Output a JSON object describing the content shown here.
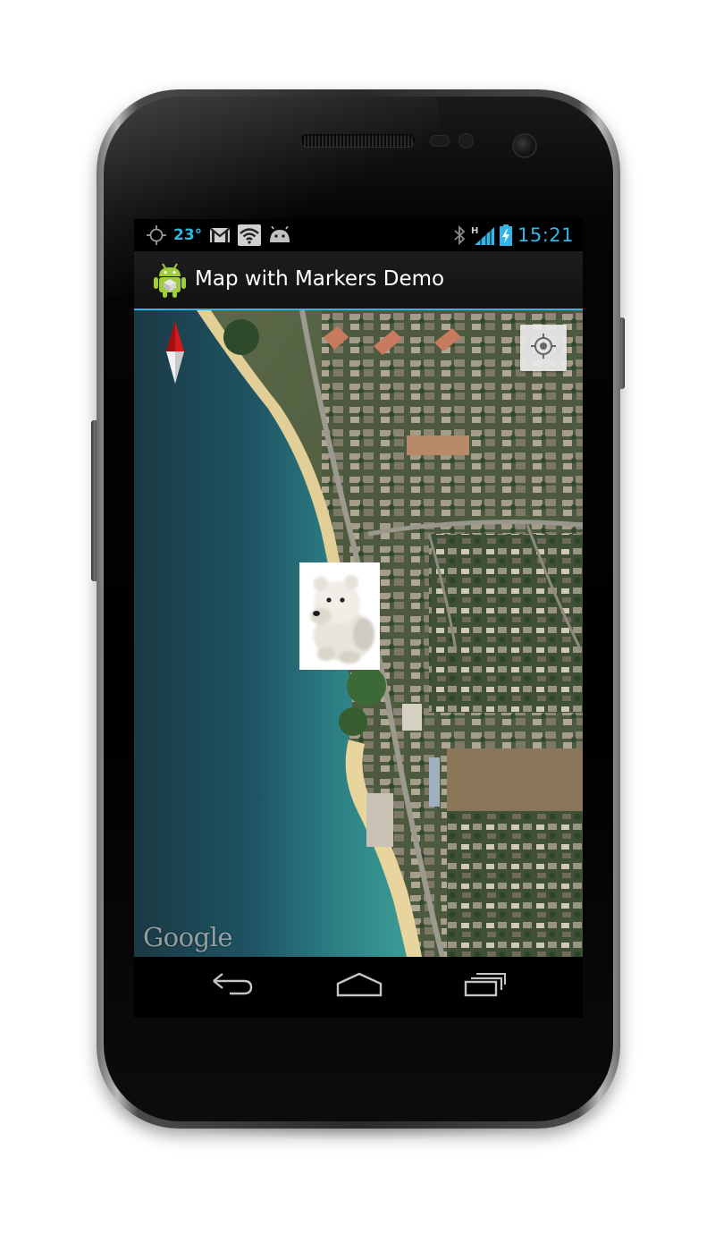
{
  "status_bar": {
    "temperature": "23°",
    "time": "15:21",
    "network_type": "H",
    "accent_color": "#33b5e5",
    "left_icons": [
      "gps-icon",
      "temperature",
      "gmail-icon",
      "wifi-icon",
      "android-icon"
    ],
    "right_icons": [
      "bluetooth-icon",
      "signal-icon",
      "battery-icon"
    ]
  },
  "action_bar": {
    "app_icon": "android-app-icon",
    "title": "Map with Markers Demo"
  },
  "map": {
    "view": "satellite",
    "compass_icon": "compass-icon",
    "my_location_icon": "my-location-icon",
    "marker_icon": "polar-bear-marker",
    "attribution": "Google"
  },
  "nav_bar": {
    "buttons": [
      "back-icon",
      "home-icon",
      "recent-apps-icon"
    ]
  }
}
